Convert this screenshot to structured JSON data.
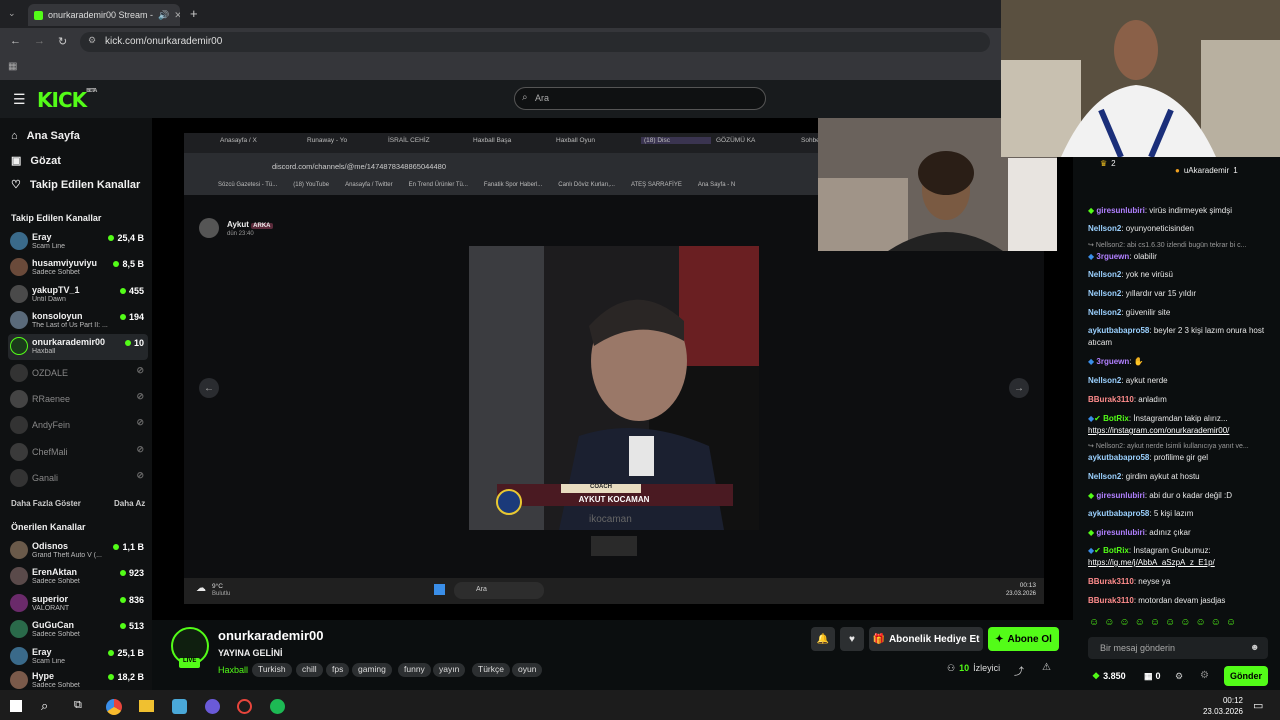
{
  "browser": {
    "tab_title": "onurkarademir00 Stream -",
    "address": "kick.com/onurkarademir00"
  },
  "kick": {
    "logo": "KICK",
    "logo_beta": "BETA",
    "search_placeholder": "Ara",
    "nav": [
      {
        "label": "Ana Sayfa",
        "icon": "home-icon"
      },
      {
        "label": "Gözat",
        "icon": "browse-icon"
      },
      {
        "label": "Takip Edilen Kanallar",
        "icon": "heart-icon"
      }
    ],
    "followed_heading": "Takip Edilen Kanallar",
    "followed": [
      {
        "name": "Eray",
        "sub": "Scam Line",
        "viewers": "25,4 B",
        "live": true
      },
      {
        "name": "husamviyuviyu",
        "sub": "Sadece Sohbet",
        "viewers": "8,5 B",
        "live": true
      },
      {
        "name": "yakupTV_1",
        "sub": "Until Dawn",
        "viewers": "455",
        "live": true
      },
      {
        "name": "konsoloyun",
        "sub": "The Last of Us Part II: ...",
        "viewers": "194",
        "live": true
      },
      {
        "name": "onurkarademir00",
        "sub": "Haxball",
        "viewers": "10",
        "live": true
      },
      {
        "name": "OZDALE",
        "sub": "",
        "viewers": "",
        "live": false
      },
      {
        "name": "RRaenee",
        "sub": "",
        "viewers": "",
        "live": false
      },
      {
        "name": "AndyFein",
        "sub": "",
        "viewers": "",
        "live": false
      },
      {
        "name": "ChefMali",
        "sub": "",
        "viewers": "",
        "live": false
      },
      {
        "name": "Ganali",
        "sub": "",
        "viewers": "",
        "live": false
      }
    ],
    "show_more": "Daha Fazla Göster",
    "show_less": "Daha Az",
    "recommended_heading": "Önerilen Kanallar",
    "recommended": [
      {
        "name": "Odisnos",
        "sub": "Grand Theft Auto V (...",
        "viewers": "1,1 B"
      },
      {
        "name": "ErenAktan",
        "sub": "Sadece Sohbet",
        "viewers": "923"
      },
      {
        "name": "superior",
        "sub": "VALORANT",
        "viewers": "836"
      },
      {
        "name": "GuGuCan",
        "sub": "Sadece Sohbet",
        "viewers": "513"
      },
      {
        "name": "Eray",
        "sub": "Scam Line",
        "viewers": "25,1 B"
      },
      {
        "name": "Hype",
        "sub": "Sadece Sohbet",
        "viewers": "18,2 B"
      }
    ]
  },
  "stream": {
    "inner_tabs": [
      "Anasayfa / X",
      "Runaway - Yo",
      "İSRAİL CEHİZ",
      "Haxball Başa",
      "Haxball Oyun",
      "(18) Disc",
      "GÖZÜMÜ KA",
      "Sohbet Botu"
    ],
    "inner_address": "discord.com/channels/@me/1474878348865044480",
    "inner_bookmarks": [
      "Sözcü Gazetesi - Tü...",
      "(18) YouTube",
      "Anasayfa / Twitter",
      "En Trend Ürünler Tü...",
      "Fanatik Spor Haberl...",
      "Canlı Döviz Kurları,...",
      "ATEŞ SARRAFİYE",
      "Ana Sayfa - N"
    ],
    "discord_user": "Aykut",
    "discord_badge": "ARKA",
    "discord_time": "dün 23:40",
    "caption_top": "COACH",
    "caption_name": "AYKUT KOCAMAN",
    "watermark": "ikocaman",
    "weather_temp": "9°C",
    "weather_desc": "Bulutlu",
    "inner_search": "Ara",
    "inner_time": "00:13",
    "inner_date": "23.03.2026"
  },
  "channel": {
    "name": "onurkarademir00",
    "title": "YAYINA GELİNİ",
    "live_badge": "LIVE",
    "category": "Haxball",
    "tags": [
      "Turkish",
      "chill",
      "fps",
      "gaming",
      "funny",
      "yayın",
      "Türkçe",
      "oyun"
    ],
    "gift_label": "Abonelik Hediye Et",
    "sub_label": "Abone Ol",
    "viewers": "10",
    "viewers_label": "İzleyici"
  },
  "chat": {
    "top_user": "uAkarademir",
    "top_count": "1",
    "left_count": "2",
    "messages": [
      {
        "user": "giresunlubiri",
        "text": "virüs indirmeyek şimdşi",
        "color": "#b180ff",
        "badge": true
      },
      {
        "user": "Nellson2",
        "text": "oyunyoneticisinden",
        "color": "#9bd1ff"
      },
      {
        "system": "Nellson2: abi cs1.6.30 izlendi bugün tekrar bi c..."
      },
      {
        "user": "3rguewn",
        "text": "olabilir",
        "color": "#b180ff",
        "badge": true
      },
      {
        "user": "Nellson2",
        "text": "yok ne virüsü",
        "color": "#9bd1ff"
      },
      {
        "user": "Nellson2",
        "text": "yıllardır var 15 yıldır",
        "color": "#9bd1ff"
      },
      {
        "user": "Nellson2",
        "text": "güvenilir site",
        "color": "#9bd1ff"
      },
      {
        "user": "aykutbabapro58",
        "text": "beyler 2 3 kişi lazım onura host atıcam",
        "color": "#9bd1ff"
      },
      {
        "user": "3rguewn",
        "text": "",
        "color": "#b180ff",
        "badge": true
      },
      {
        "user": "Nellson2",
        "text": "aykut nerde",
        "color": "#9bd1ff"
      },
      {
        "user": "BBurak3110",
        "text": "anladım",
        "color": "#ff8c8c"
      },
      {
        "user": "BotRix",
        "text": "İnstagramdan takip alırız...",
        "link": "https://instagram.com/onurkarademir00/",
        "color": "#53fc18",
        "badge": true
      },
      {
        "system": "Nellson2: aykut nerde İsimli kullanıcıya yanıt ve..."
      },
      {
        "user": "aykutbabapro58",
        "text": "profilime gir gel",
        "color": "#9bd1ff"
      },
      {
        "user": "Nellson2",
        "text": "girdim aykut at hostu",
        "color": "#9bd1ff"
      },
      {
        "user": "giresunlubiri",
        "text": "abi dur o kadar değil :D",
        "color": "#b180ff",
        "badge": true
      },
      {
        "user": "aykutbabapro58",
        "text": "5 kişi lazım",
        "color": "#9bd1ff"
      },
      {
        "user": "giresunlubiri",
        "text": "adınız çıkar",
        "color": "#b180ff",
        "badge": true
      },
      {
        "user": "BotRix",
        "text": "İnstagram Grubumuz:",
        "link": "https://ig.me/j/AbbA_aSzpA_z_E1p/",
        "color": "#53fc18",
        "badge": true
      },
      {
        "user": "BBurak3110",
        "text": "neyse ya",
        "color": "#ff8c8c"
      },
      {
        "user": "BBurak3110",
        "text": "motordan devam jasdjas",
        "color": "#ff8c8c"
      }
    ],
    "input_placeholder": "Bir mesaj gönderin",
    "points": "3.850",
    "other_count": "0",
    "send": "Gönder"
  },
  "os": {
    "time": "00:12",
    "date": "23.03.2026"
  }
}
